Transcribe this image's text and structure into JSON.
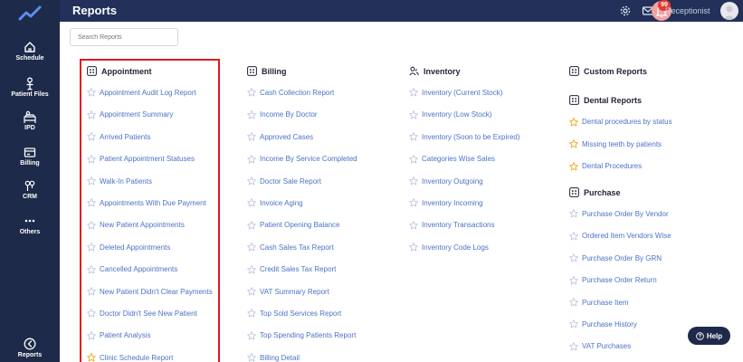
{
  "sidebar": {
    "items": [
      {
        "label": "Schedule",
        "icon": "home-icon"
      },
      {
        "label": "Patient Files",
        "icon": "person-icon"
      },
      {
        "label": "IPD",
        "icon": "bed-icon"
      },
      {
        "label": "Billing",
        "icon": "billing-icon"
      },
      {
        "label": "CRM",
        "icon": "crm-icon"
      },
      {
        "label": "Others",
        "icon": "more-icon"
      },
      {
        "label": "Reports",
        "icon": "reports-icon"
      }
    ]
  },
  "header": {
    "title": "Reports",
    "notification_count": "99",
    "user_role": "Receptionist"
  },
  "search": {
    "placeholder": "Search Reports"
  },
  "columns": [
    {
      "sections": [
        {
          "title": "Appointment",
          "icon": "calendar-icon",
          "reports": [
            {
              "label": "Appointment Audit Log Report",
              "favorite": false
            },
            {
              "label": "Appointment Summary",
              "favorite": false
            },
            {
              "label": "Arrived Patients",
              "favorite": false
            },
            {
              "label": "Patient Appointment Statuses",
              "favorite": false
            },
            {
              "label": "Walk-In Patients",
              "favorite": false
            },
            {
              "label": "Appointments With Due Payment",
              "favorite": false
            },
            {
              "label": "New Patient Appointments",
              "favorite": false
            },
            {
              "label": "Deleted Appointments",
              "favorite": false
            },
            {
              "label": "Cancelled Appointments",
              "favorite": false
            },
            {
              "label": "New Patient Didn't Clear Payments",
              "favorite": false
            },
            {
              "label": "Doctor Didn't See New Patient",
              "favorite": false
            },
            {
              "label": "Patient Analysis",
              "favorite": false
            },
            {
              "label": "Clinic Schedule Report",
              "favorite": true
            }
          ]
        }
      ]
    },
    {
      "sections": [
        {
          "title": "Billing",
          "icon": "calendar-icon",
          "reports": [
            {
              "label": "Cash Collection Report",
              "favorite": false
            },
            {
              "label": "Income By Doctor",
              "favorite": false
            },
            {
              "label": "Approved Cases",
              "favorite": false
            },
            {
              "label": "Income By Service Completed",
              "favorite": false
            },
            {
              "label": "Doctor Sale Report",
              "favorite": false
            },
            {
              "label": "Invoice Aging",
              "favorite": false
            },
            {
              "label": "Patient Opening Balance",
              "favorite": false
            },
            {
              "label": "Cash Sales Tax Report",
              "favorite": false
            },
            {
              "label": "Credit Sales Tax Report",
              "favorite": false
            },
            {
              "label": "VAT Summary Report",
              "favorite": false
            },
            {
              "label": "Top Sold Services Report",
              "favorite": false
            },
            {
              "label": "Top Spending Patients Report",
              "favorite": false
            },
            {
              "label": "Billing Detail",
              "favorite": false
            }
          ]
        }
      ]
    },
    {
      "sections": [
        {
          "title": "Inventory",
          "icon": "people-icon",
          "reports": [
            {
              "label": "Inventory (Current Stock)",
              "favorite": false
            },
            {
              "label": "Inventory (Low Stock)",
              "favorite": false
            },
            {
              "label": "Inventory (Soon to be Expired)",
              "favorite": false
            },
            {
              "label": "Categories Wise Sales",
              "favorite": false
            },
            {
              "label": "Inventory Outgoing",
              "favorite": false
            },
            {
              "label": "Inventory Incoming",
              "favorite": false
            },
            {
              "label": "Inventory Transactions",
              "favorite": false
            },
            {
              "label": "Inventory Code Logs",
              "favorite": false
            }
          ]
        }
      ]
    },
    {
      "sections": [
        {
          "title": "Custom Reports",
          "icon": "calendar-icon",
          "reports": []
        },
        {
          "title": "Dental Reports",
          "icon": "calendar-icon",
          "reports": [
            {
              "label": "Dental procedures by status",
              "favorite": true
            },
            {
              "label": "Missing teeth by patients",
              "favorite": true
            },
            {
              "label": "Dental Procedures",
              "favorite": true
            }
          ]
        },
        {
          "title": "Purchase",
          "icon": "calendar-icon",
          "reports": [
            {
              "label": "Purchase Order By Vendor",
              "favorite": false
            },
            {
              "label": "Ordered Item Vendors Wise",
              "favorite": false
            },
            {
              "label": "Purchase Order By GRN",
              "favorite": false
            },
            {
              "label": "Purchase Order Return",
              "favorite": false
            },
            {
              "label": "Purchase Item",
              "favorite": false
            },
            {
              "label": "Purchase History",
              "favorite": false
            },
            {
              "label": "VAT Purchases",
              "favorite": false
            }
          ]
        }
      ]
    }
  ],
  "help": {
    "label": "Help"
  },
  "colors": {
    "sidebar": "#1e2a4a",
    "header": "#22305a",
    "link": "#4c72c7",
    "star_empty": "#b9c3dc",
    "star_favorite": "#f0a81c",
    "highlight": "#e0191f"
  }
}
